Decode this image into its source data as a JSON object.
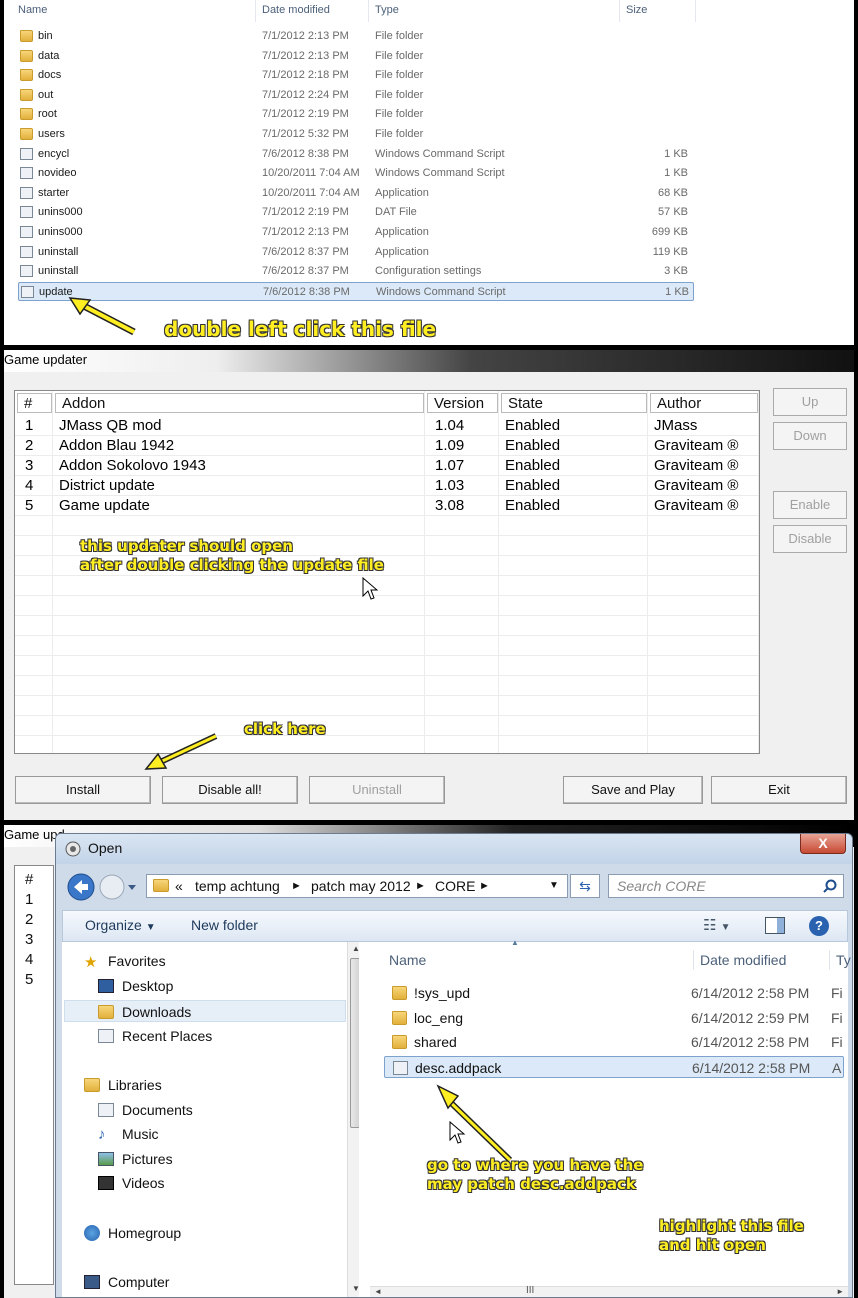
{
  "panel1": {
    "headers": {
      "name": "Name",
      "date": "Date modified",
      "type": "Type",
      "size": "Size"
    },
    "rows": [
      {
        "name": "bin",
        "date": "7/1/2012 2:13 PM",
        "type": "File folder",
        "size": "",
        "icon": "folder-icon"
      },
      {
        "name": "data",
        "date": "7/1/2012 2:13 PM",
        "type": "File folder",
        "size": "",
        "icon": "folder-icon"
      },
      {
        "name": "docs",
        "date": "7/1/2012 2:18 PM",
        "type": "File folder",
        "size": "",
        "icon": "folder-icon"
      },
      {
        "name": "out",
        "date": "7/1/2012 2:24 PM",
        "type": "File folder",
        "size": "",
        "icon": "folder-icon"
      },
      {
        "name": "root",
        "date": "7/1/2012 2:19 PM",
        "type": "File folder",
        "size": "",
        "icon": "folder-icon"
      },
      {
        "name": "users",
        "date": "7/1/2012 5:32 PM",
        "type": "File folder",
        "size": "",
        "icon": "folder-icon"
      },
      {
        "name": "encycl",
        "date": "7/6/2012 8:38 PM",
        "type": "Windows Command Script",
        "size": "1 KB",
        "icon": "script-icon"
      },
      {
        "name": "novideo",
        "date": "10/20/2011 7:04 AM",
        "type": "Windows Command Script",
        "size": "1 KB",
        "icon": "script-icon"
      },
      {
        "name": "starter",
        "date": "10/20/2011 7:04 AM",
        "type": "Application",
        "size": "68 KB",
        "icon": "application-icon"
      },
      {
        "name": "unins000",
        "date": "7/1/2012 2:19 PM",
        "type": "DAT File",
        "size": "57 KB",
        "icon": "dat-file-icon"
      },
      {
        "name": "unins000",
        "date": "7/1/2012 2:13 PM",
        "type": "Application",
        "size": "699 KB",
        "icon": "installer-icon"
      },
      {
        "name": "uninstall",
        "date": "7/6/2012 8:37 PM",
        "type": "Application",
        "size": "119 KB",
        "icon": "installer-icon"
      },
      {
        "name": "uninstall",
        "date": "7/6/2012 8:37 PM",
        "type": "Configuration settings",
        "size": "3 KB",
        "icon": "settings-file-icon"
      },
      {
        "name": "update",
        "date": "7/6/2012 8:38 PM",
        "type": "Windows Command Script",
        "size": "1 KB",
        "icon": "script-icon"
      }
    ],
    "annotation": "double left click this file"
  },
  "panel2": {
    "title": "Game updater",
    "columns": [
      "#",
      "Addon",
      "Version",
      "State",
      "Author"
    ],
    "rows": [
      [
        "1",
        "JMass QB mod",
        "1.04",
        "Enabled",
        "JMass"
      ],
      [
        "2",
        "Addon Blau 1942",
        "1.09",
        "Enabled",
        "Graviteam ®"
      ],
      [
        "3",
        "Addon Sokolovo 1943",
        "1.07",
        "Enabled",
        "Graviteam ®"
      ],
      [
        "4",
        "District update",
        "1.03",
        "Enabled",
        "Graviteam ®"
      ],
      [
        "5",
        "Game update",
        "3.08",
        "Enabled",
        "Graviteam ®"
      ]
    ],
    "side_buttons": {
      "up": "Up",
      "down": "Down",
      "enable": "Enable",
      "disable": "Disable"
    },
    "bottom_buttons": {
      "install": "Install",
      "disable_all": "Disable all!",
      "uninstall": "Uninstall",
      "save_and_play": "Save and Play",
      "exit": "Exit"
    },
    "annotation_line1": "this updater should open",
    "annotation_line2": "after double clicking the update file",
    "annotation_click": "click here"
  },
  "panel3": {
    "background_title": "Game upd",
    "background_rows": [
      "#",
      "1",
      "2",
      "3",
      "4",
      "5"
    ],
    "dialog_title": "Open",
    "close_label": "X",
    "address": {
      "prefix": "«",
      "parts": [
        "temp achtung",
        "patch may 2012",
        "CORE"
      ]
    },
    "search_placeholder": "Search CORE",
    "toolbar": {
      "organize": "Organize",
      "new_folder": "New folder"
    },
    "nav": {
      "favorites": "Favorites",
      "desktop": "Desktop",
      "downloads": "Downloads",
      "recent_places": "Recent Places",
      "libraries": "Libraries",
      "documents": "Documents",
      "music": "Music",
      "pictures": "Pictures",
      "videos": "Videos",
      "homegroup": "Homegroup",
      "computer": "Computer"
    },
    "file_headers": {
      "name": "Name",
      "date": "Date modified",
      "type": "Ty"
    },
    "files": [
      {
        "name": "!sys_upd",
        "date": "6/14/2012 2:58 PM",
        "type": "Fi",
        "icon": "folder-icon"
      },
      {
        "name": "loc_eng",
        "date": "6/14/2012 2:59 PM",
        "type": "Fi",
        "icon": "folder-icon"
      },
      {
        "name": "shared",
        "date": "6/14/2012 2:58 PM",
        "type": "Fi",
        "icon": "folder-icon"
      },
      {
        "name": "desc.addpack",
        "date": "6/14/2012 2:58 PM",
        "type": "A",
        "icon": "file-icon"
      }
    ],
    "scroll_grip": "III",
    "annotation_goto_1": "go to where you have the",
    "annotation_goto_2": "may patch desc.addpack",
    "annotation_open_1": "highlight this file",
    "annotation_open_2": "and hit open"
  },
  "colors": {
    "annotation": "#ffee22",
    "selection": "#dbe9f8",
    "selection_border": "#7da2ce",
    "close_red": "#c74a33"
  }
}
